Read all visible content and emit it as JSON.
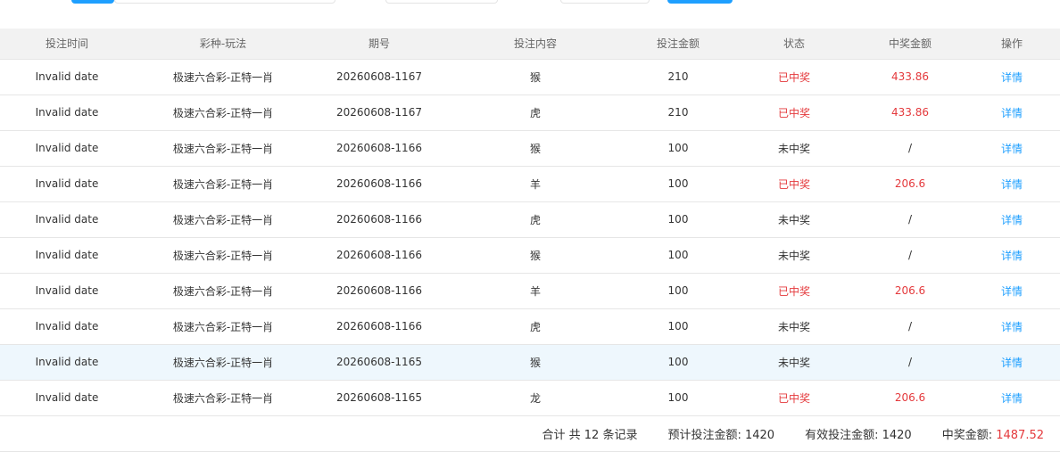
{
  "colors": {
    "accent": "#1e9fff",
    "won": "#e4393c",
    "header_bg": "#f2f2f2",
    "highlight_row": "#eef7fd"
  },
  "table": {
    "headers": [
      "投注时间",
      "彩种-玩法",
      "期号",
      "投注内容",
      "投注金额",
      "状态",
      "中奖金额",
      "操作"
    ],
    "rows": [
      {
        "time": "Invalid date",
        "game": "极速六合彩-正特一肖",
        "issue": "20260608-1167",
        "content": "猴",
        "amount": "210",
        "status": "已中奖",
        "won": true,
        "prize": "433.86",
        "action": "详情"
      },
      {
        "time": "Invalid date",
        "game": "极速六合彩-正特一肖",
        "issue": "20260608-1167",
        "content": "虎",
        "amount": "210",
        "status": "已中奖",
        "won": true,
        "prize": "433.86",
        "action": "详情"
      },
      {
        "time": "Invalid date",
        "game": "极速六合彩-正特一肖",
        "issue": "20260608-1166",
        "content": "猴",
        "amount": "100",
        "status": "未中奖",
        "won": false,
        "prize": "/",
        "action": "详情"
      },
      {
        "time": "Invalid date",
        "game": "极速六合彩-正特一肖",
        "issue": "20260608-1166",
        "content": "羊",
        "amount": "100",
        "status": "已中奖",
        "won": true,
        "prize": "206.6",
        "action": "详情"
      },
      {
        "time": "Invalid date",
        "game": "极速六合彩-正特一肖",
        "issue": "20260608-1166",
        "content": "虎",
        "amount": "100",
        "status": "未中奖",
        "won": false,
        "prize": "/",
        "action": "详情"
      },
      {
        "time": "Invalid date",
        "game": "极速六合彩-正特一肖",
        "issue": "20260608-1166",
        "content": "猴",
        "amount": "100",
        "status": "未中奖",
        "won": false,
        "prize": "/",
        "action": "详情"
      },
      {
        "time": "Invalid date",
        "game": "极速六合彩-正特一肖",
        "issue": "20260608-1166",
        "content": "羊",
        "amount": "100",
        "status": "已中奖",
        "won": true,
        "prize": "206.6",
        "action": "详情"
      },
      {
        "time": "Invalid date",
        "game": "极速六合彩-正特一肖",
        "issue": "20260608-1166",
        "content": "虎",
        "amount": "100",
        "status": "未中奖",
        "won": false,
        "prize": "/",
        "action": "详情"
      },
      {
        "time": "Invalid date",
        "game": "极速六合彩-正特一肖",
        "issue": "20260608-1165",
        "content": "猴",
        "amount": "100",
        "status": "未中奖",
        "won": false,
        "prize": "/",
        "action": "详情",
        "highlighted": true
      },
      {
        "time": "Invalid date",
        "game": "极速六合彩-正特一肖",
        "issue": "20260608-1165",
        "content": "龙",
        "amount": "100",
        "status": "已中奖",
        "won": true,
        "prize": "206.6",
        "action": "详情"
      }
    ]
  },
  "summary": {
    "total_records": "合计 共 12 条记录",
    "expected_label": "预计投注金额:",
    "expected_value": "1420",
    "valid_label": "有效投注金额:",
    "valid_value": "1420",
    "prize_label": "中奖金额:",
    "prize_value": "1487.52"
  }
}
